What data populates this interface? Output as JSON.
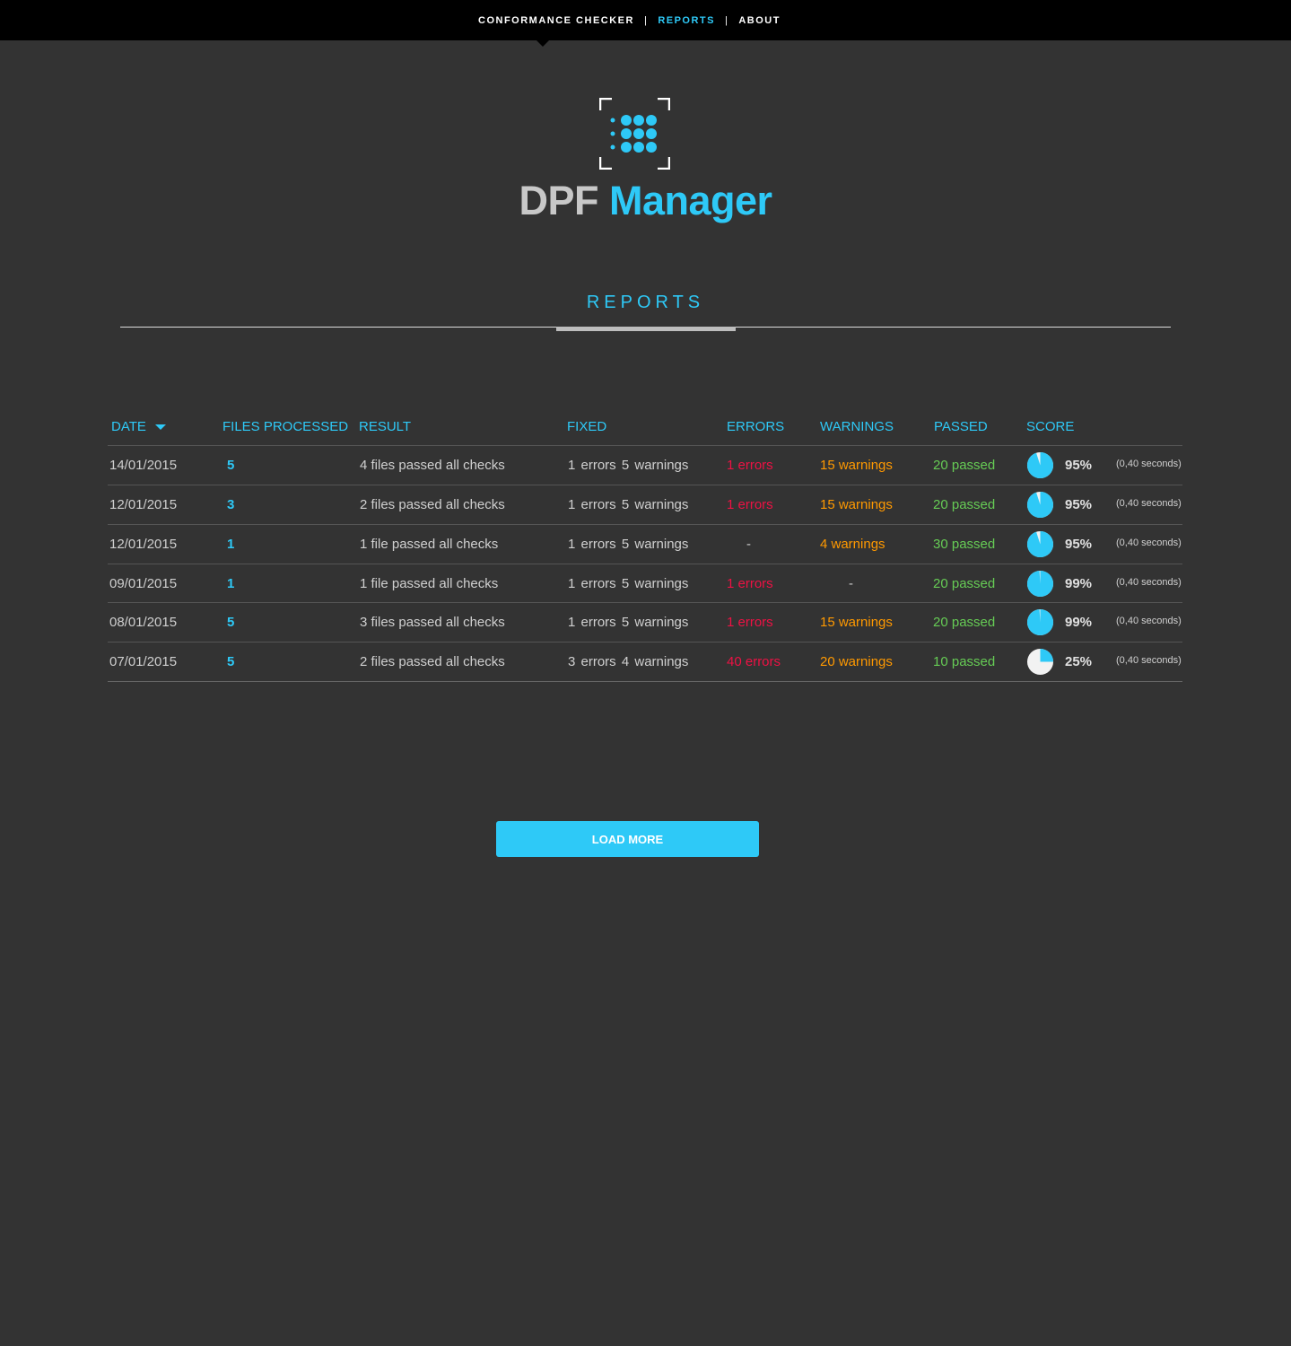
{
  "nav": {
    "items": [
      {
        "label": "CONFORMANCE CHECKER",
        "active": false
      },
      {
        "label": "REPORTS",
        "active": true
      },
      {
        "label": "ABOUT",
        "active": false
      }
    ],
    "separator": "|"
  },
  "logo": {
    "part1": "DPF",
    "part2": "Manager"
  },
  "page": {
    "section_title": "REPORTS",
    "load_more": "LOAD MORE"
  },
  "colors": {
    "accent": "#2ec9f7",
    "errors": "#ee1144",
    "warnings": "#ff9900",
    "passed": "#66cc55",
    "background": "#333333"
  },
  "table": {
    "headers": {
      "date": "DATE",
      "files": "FILES PROCESSED",
      "result": "RESULT",
      "fixed": "FIXED",
      "errors": "ERRORS",
      "warnings": "WARNINGS",
      "passed": "PASSED",
      "score": "SCORE"
    },
    "rows": [
      {
        "date": "14/01/2015",
        "files": "5",
        "result": "4 files passed all checks",
        "fixed": "1 errors  5 warnings",
        "errors": "1 errors",
        "warnings": "15 warnings",
        "passed": "20 passed",
        "score": "95%",
        "score_value": 0.95,
        "time": "(0,40 seconds)"
      },
      {
        "date": "12/01/2015",
        "files": "3",
        "result": "2 files passed all checks",
        "fixed": "1 errors  5 warnings",
        "errors": "1 errors",
        "warnings": "15 warnings",
        "passed": "20 passed",
        "score": "95%",
        "score_value": 0.95,
        "time": "(0,40 seconds)"
      },
      {
        "date": "12/01/2015",
        "files": "1",
        "result": "1 file passed all checks",
        "fixed": "1 errors  5 warnings",
        "errors": "-",
        "warnings": "4 warnings",
        "passed": "30 passed",
        "score": "95%",
        "score_value": 0.95,
        "time": "(0,40 seconds)"
      },
      {
        "date": "09/01/2015",
        "files": "1",
        "result": "1 file passed all checks",
        "fixed": "1 errors  5 warnings",
        "errors": "1 errors",
        "warnings": "-",
        "passed": "20 passed",
        "score": "99%",
        "score_value": 0.99,
        "time": "(0,40 seconds)"
      },
      {
        "date": "08/01/2015",
        "files": "5",
        "result": "3 files passed all checks",
        "fixed": "1 errors  5 warnings",
        "errors": "1 errors",
        "warnings": "15 warnings",
        "passed": "20 passed",
        "score": "99%",
        "score_value": 0.99,
        "time": "(0,40 seconds)"
      },
      {
        "date": "07/01/2015",
        "files": "5",
        "result": "2 files passed all checks",
        "fixed": "3 errors  4 warnings",
        "errors": "40 errors",
        "warnings": "20 warnings",
        "passed": "10 passed",
        "score": "25%",
        "score_value": 0.25,
        "time": "(0,40 seconds)"
      }
    ]
  }
}
